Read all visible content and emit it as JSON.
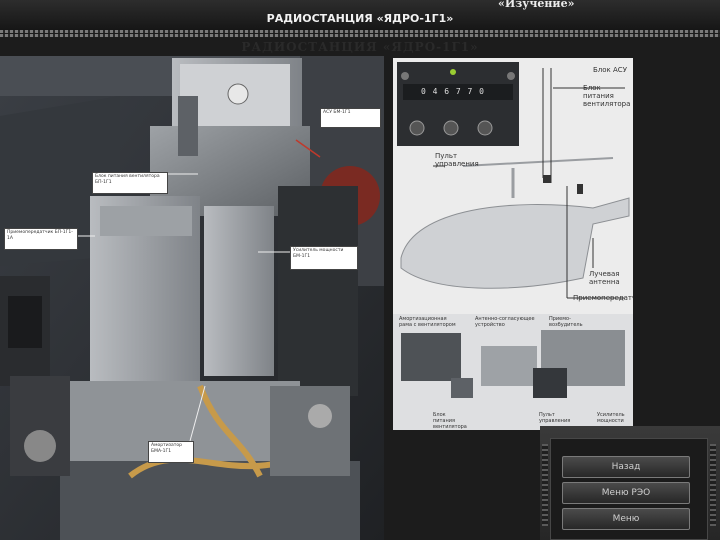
{
  "header": {
    "faint_title": "",
    "mode": "«Изучение»",
    "subtitle": "РАДИОСТАНЦИЯ «ЯДРО-1Г1»"
  },
  "page_heading": "РАДИОСТАНЦИЯ «ЯДРО-1Г1»",
  "photo_labels": {
    "asu": "АСУ БМ-1Г1",
    "power": "Блок питания вентилятора БП-1Г1",
    "receiver": "Приемопередатчик БП-1Г1-1А",
    "amp": "Усилитель мощности БМ-1Г1",
    "antenna": "Амортизатор БМА-1Г1"
  },
  "diagram": {
    "display_digits": "0 4 6 7 7 0",
    "callouts": {
      "asu_block": "Блок АСУ",
      "fan_power": "Блок питания вентилятора",
      "control_panel": "Пульт управления",
      "antenna_beam": "Лучевая антенна",
      "transceiver": "Приемопередатчик"
    },
    "bottom_labels": {
      "frame": "Амортизационная рама с вентилятором",
      "ant_match": "Антенно-согласующее устройство",
      "receiver_exc": "Приемо-возбудитель",
      "fan_power": "Блок питания вентилятора",
      "control_panel": "Пульт управления",
      "power_amp": "Усилитель мощности"
    }
  },
  "menu": {
    "items": [
      "Назад",
      "Меню РЭО",
      "Меню"
    ]
  },
  "colors": {
    "background": "#1c1c1c",
    "accent_text": "#ececec"
  }
}
